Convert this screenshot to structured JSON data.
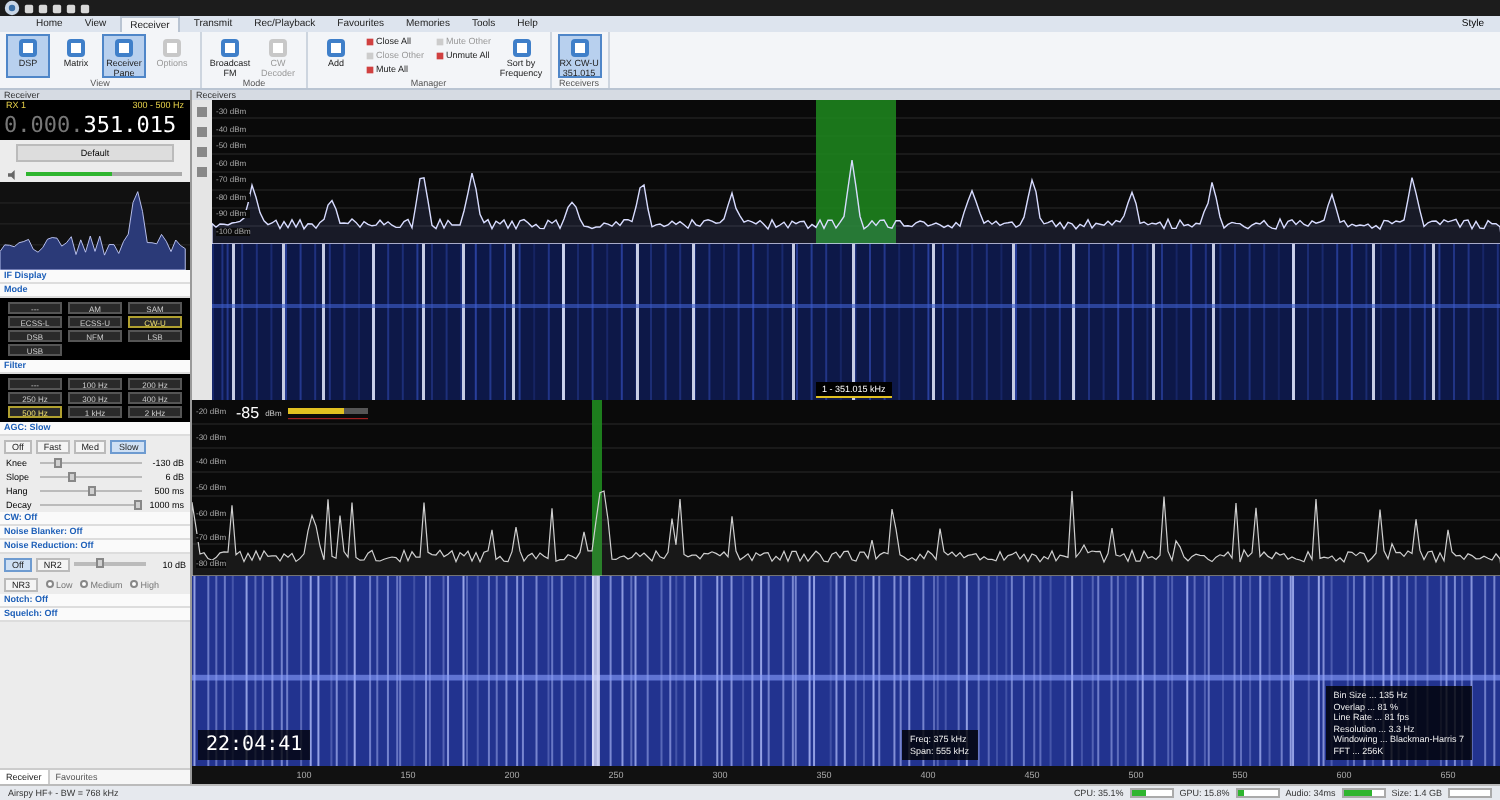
{
  "menu_tabs": [
    {
      "label": "Home",
      "selected": false
    },
    {
      "label": "View",
      "selected": false
    },
    {
      "label": "Receiver",
      "selected": true
    },
    {
      "label": "Transmit",
      "selected": false
    },
    {
      "label": "Rec/Playback",
      "selected": false
    },
    {
      "label": "Favourites",
      "selected": false
    },
    {
      "label": "Memories",
      "selected": false
    },
    {
      "label": "Tools",
      "selected": false
    },
    {
      "label": "Help",
      "selected": false
    }
  ],
  "style_menu": "Style",
  "ribbon_groups": [
    {
      "title": "View",
      "buttons": [
        {
          "label": "DSP",
          "kind": "large",
          "selected": true,
          "disabled": false
        },
        {
          "label": "Matrix",
          "kind": "large",
          "selected": false,
          "disabled": false
        },
        {
          "label": "Receiver Pane",
          "kind": "large",
          "selected": true,
          "disabled": false
        },
        {
          "label": "Options",
          "kind": "large",
          "selected": false,
          "disabled": true
        }
      ]
    },
    {
      "title": "Mode",
      "buttons": [
        {
          "label": "Broadcast FM",
          "kind": "large",
          "selected": false,
          "disabled": false
        },
        {
          "label": "CW Decoder",
          "kind": "large",
          "selected": false,
          "disabled": true
        }
      ]
    },
    {
      "title": "Manager",
      "buttons": [
        {
          "label": "Add",
          "kind": "large",
          "selected": false,
          "disabled": false
        },
        {
          "label": "Close All",
          "kind": "small",
          "disabled": false
        },
        {
          "label": "Close Other",
          "kind": "small",
          "disabled": true
        },
        {
          "label": "Mute All",
          "kind": "small",
          "disabled": false
        },
        {
          "label": "Mute Other",
          "kind": "small",
          "disabled": true
        },
        {
          "label": "Unmute All",
          "kind": "small",
          "disabled": false
        },
        {
          "label": "Sort by Frequency",
          "kind": "large",
          "selected": false,
          "disabled": false
        }
      ]
    },
    {
      "title": "Receivers",
      "buttons": [
        {
          "label": "RX CW-U 351.015",
          "kind": "large",
          "selected": true,
          "disabled": false
        }
      ]
    }
  ],
  "receiver_panel": {
    "title": "Receiver",
    "rx_label": "RX 1",
    "bandwidth": "300 - 500 Hz",
    "frequency_prefix": "0.000.",
    "frequency": "351.015",
    "preset": "Default",
    "volume": {
      "level": 0.55
    },
    "if_display": "IF Display",
    "mode": {
      "title": "Mode",
      "buttons": [
        {
          "label": "---",
          "selected": false
        },
        {
          "label": "AM",
          "selected": false
        },
        {
          "label": "SAM",
          "selected": false
        },
        {
          "label": "ECSS-L",
          "selected": false
        },
        {
          "label": "ECSS-U",
          "selected": false
        },
        {
          "label": "CW-U",
          "selected": true
        },
        {
          "label": "DSB",
          "selected": false
        },
        {
          "label": "NFM",
          "selected": false
        },
        {
          "label": "LSB",
          "selected": false
        },
        {
          "label": "USB",
          "selected": false
        }
      ]
    },
    "filter": {
      "title": "Filter",
      "buttons": [
        {
          "label": "---",
          "selected": false
        },
        {
          "label": "100 Hz",
          "selected": false
        },
        {
          "label": "200 Hz",
          "selected": false
        },
        {
          "label": "250 Hz",
          "selected": false
        },
        {
          "label": "300 Hz",
          "selected": false
        },
        {
          "label": "400 Hz",
          "selected": false
        },
        {
          "label": "500 Hz",
          "selected": true
        },
        {
          "label": "1 kHz",
          "selected": false
        },
        {
          "label": "2 kHz",
          "selected": false
        }
      ]
    },
    "agc": {
      "title": "AGC: Slow",
      "buttons": [
        {
          "label": "Off",
          "selected": false
        },
        {
          "label": "Fast",
          "selected": false
        },
        {
          "label": "Med",
          "selected": false
        },
        {
          "label": "Slow",
          "selected": true
        }
      ],
      "sliders": [
        {
          "name": "Knee",
          "level": 0.15,
          "reading": "-130 dB"
        },
        {
          "name": "Slope",
          "level": 0.3,
          "reading": "6 dB"
        },
        {
          "name": "Hang",
          "level": 0.5,
          "reading": "500 ms"
        },
        {
          "name": "Decay",
          "level": 1.0,
          "reading": "1000 ms"
        }
      ]
    },
    "cw": "CW: Off",
    "noise_blanker": "Noise Blanker: Off",
    "noise_reduction": "Noise Reduction: Off",
    "nr_buttons": [
      {
        "label": "Off",
        "selected": true
      },
      {
        "label": "NR2",
        "selected": false
      }
    ],
    "nr_level": {
      "level": 0.35,
      "reading": "10 dB"
    },
    "nr3": {
      "label": "NR3",
      "options": [
        {
          "label": "Low",
          "selected": false
        },
        {
          "label": "Medium",
          "selected": false
        },
        {
          "label": "High",
          "selected": false
        }
      ]
    },
    "notch": "Notch: Off",
    "squelch": "Squelch: Off",
    "tabs": [
      {
        "label": "Receiver",
        "selected": true
      },
      {
        "label": "Favourites",
        "selected": false
      }
    ]
  },
  "receivers": {
    "title": "Receivers",
    "top_spectrum": {
      "db_labels": [
        "-30 dBm",
        "-40 dBm",
        "-50 dBm",
        "-60 dBm",
        "-70 dBm",
        "-80 dBm",
        "-90 dBm",
        "-100 dBm"
      ]
    },
    "top_marker": "1 - 351.015 kHz",
    "main_spectrum": {
      "readout": "-85",
      "unit": "dBm",
      "db_labels": [
        "-20 dBm",
        "-30 dBm",
        "-40 dBm",
        "-50 dBm",
        "-60 dBm",
        "-70 dBm",
        "-80 dBm"
      ]
    },
    "clock": "22:04:41",
    "info": [
      "Freq: 375 kHz",
      "Span: 555 kHz"
    ],
    "fft_info": [
      "Bin Size ... 135 Hz",
      "Overlap ... 81 %",
      "Line Rate ... 81 fps",
      "Resolution ... 3.3 Hz",
      "Windowing ... Blackman-Harris 7",
      "FFT ... 256K"
    ],
    "freq_axis": [
      "100",
      "150",
      "200",
      "250",
      "300",
      "350",
      "400",
      "450",
      "500",
      "550",
      "600",
      "650"
    ]
  },
  "status_left": "Airspy HF+ - BW = 768 kHz",
  "status_meters": [
    {
      "label": "CPU: 35.1%",
      "level": 0.35
    },
    {
      "label": "GPU: 15.8%",
      "level": 0.16
    },
    {
      "label": "Audio: 34ms",
      "level": 0.7
    },
    {
      "label": "Size: 1.4 GB"
    }
  ]
}
